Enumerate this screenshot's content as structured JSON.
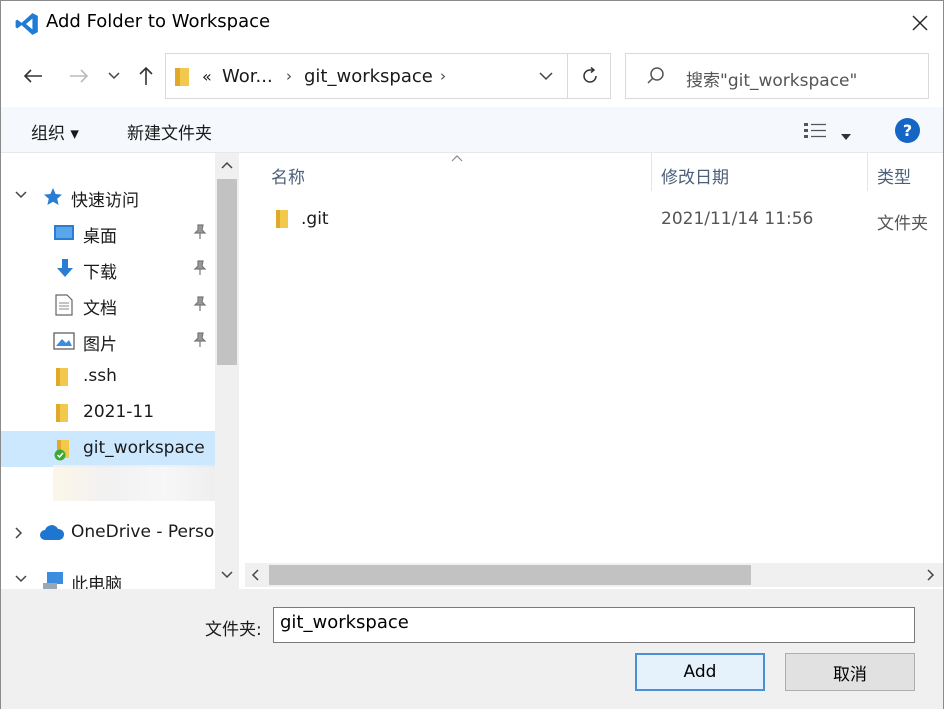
{
  "window": {
    "title": "Add Folder to Workspace"
  },
  "address": {
    "overflow": "«",
    "crumbs": [
      "Wor...",
      "git_workspace"
    ]
  },
  "search": {
    "placeholder": "搜索\"git_workspace\""
  },
  "toolbar": {
    "organize": "组织 ▾",
    "new_folder": "新建文件夹"
  },
  "sidebar": {
    "quick_access": "快速访问",
    "items": [
      {
        "label": "桌面",
        "icon": "desktop-icon",
        "pinned": true
      },
      {
        "label": "下载",
        "icon": "download-icon",
        "pinned": true
      },
      {
        "label": "文档",
        "icon": "document-icon",
        "pinned": true
      },
      {
        "label": "图片",
        "icon": "picture-icon",
        "pinned": true
      },
      {
        "label": ".ssh",
        "icon": "folder-icon",
        "pinned": false
      },
      {
        "label": "2021-11",
        "icon": "folder-icon",
        "pinned": false
      },
      {
        "label": "git_workspace",
        "icon": "folder-icon",
        "pinned": false,
        "selected": true
      }
    ],
    "onedrive": "OneDrive - Perso",
    "this_pc": "此电脑"
  },
  "file_list": {
    "columns": [
      "名称",
      "修改日期",
      "类型"
    ],
    "rows": [
      {
        "name": ".git",
        "modified": "2021/11/14 11:56",
        "type": "文件夹"
      }
    ]
  },
  "footer": {
    "folder_label": "文件夹:",
    "folder_value": "git_workspace",
    "add_button": "Add",
    "cancel_button": "取消"
  },
  "colors": {
    "accent": "#1566c4",
    "selection": "#cce8ff",
    "folder": "#f2c94c"
  }
}
